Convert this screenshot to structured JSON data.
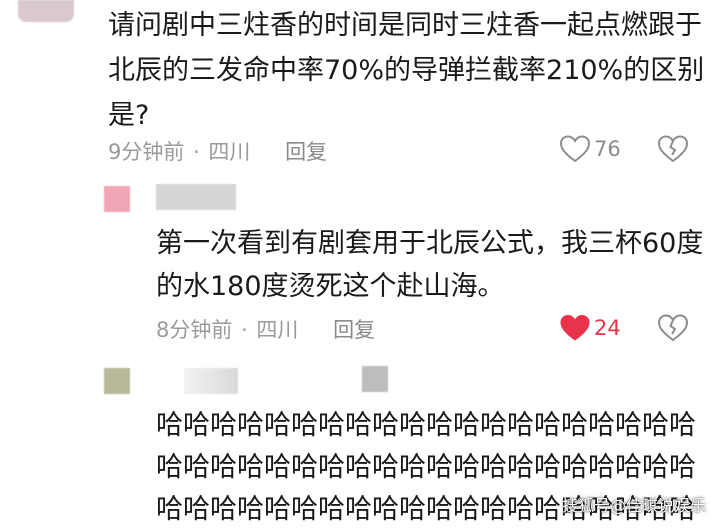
{
  "comment1": {
    "lines": [
      "请问剧中三炷香的时间是同时三炷香一起点燃跟于",
      "北辰的三发命中率70%的导弹拦截率210%的区别",
      "是?"
    ],
    "time": "9分钟前",
    "location": "四川",
    "reply_label": "回复",
    "likes": "76"
  },
  "reply1": {
    "lines": [
      "第一次看到有剧套用于北辰公式，我三杯60度",
      "的水180度烫死这个赴山海。"
    ],
    "time": "8分钟前",
    "location": "四川",
    "reply_label": "回复",
    "likes": "24"
  },
  "reply2": {
    "lines": [
      "哈哈哈哈哈哈哈哈哈哈哈哈哈哈哈哈哈哈哈哈",
      "哈哈哈哈哈哈哈哈哈哈哈哈哈哈哈哈哈哈哈哈",
      "哈哈哈哈哈哈哈哈哈哈哈哈哈哈哈哈哈哈哈哈"
    ]
  },
  "watermark": "搜狐号@佳琪说娱乐",
  "colors": {
    "liked": "#e8344a",
    "meta_gray": "#9a9a9a",
    "avatar_pink": "#f2a6b5",
    "avatar_olive": "#b8b99a"
  }
}
